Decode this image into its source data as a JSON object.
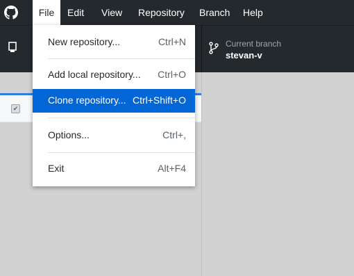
{
  "app": {
    "icon": "github-octocat-icon"
  },
  "menubar": {
    "items": [
      {
        "label": "File",
        "active": true
      },
      {
        "label": "Edit"
      },
      {
        "label": "View"
      },
      {
        "label": "Repository"
      },
      {
        "label": "Branch"
      },
      {
        "label": "Help"
      }
    ]
  },
  "toolbar": {
    "repo_icon": "repo-icon",
    "current_branch_label": "Current branch",
    "current_branch_name": "stevan-v",
    "branch_icon": "git-branch-icon"
  },
  "file_menu": {
    "items": [
      {
        "label": "New repository...",
        "shortcut": "Ctrl+N"
      },
      {
        "label": "Add local repository...",
        "shortcut": "Ctrl+O"
      },
      {
        "label": "Clone repository...",
        "shortcut": "Ctrl+Shift+O",
        "highlighted": true
      },
      {
        "label": "Options...",
        "shortcut": "Ctrl+,"
      },
      {
        "label": "Exit",
        "shortcut": "Alt+F4"
      }
    ]
  },
  "colors": {
    "titlebar": "#24292e",
    "highlight": "#0366d6",
    "accent_tab": "#2f7de1"
  }
}
